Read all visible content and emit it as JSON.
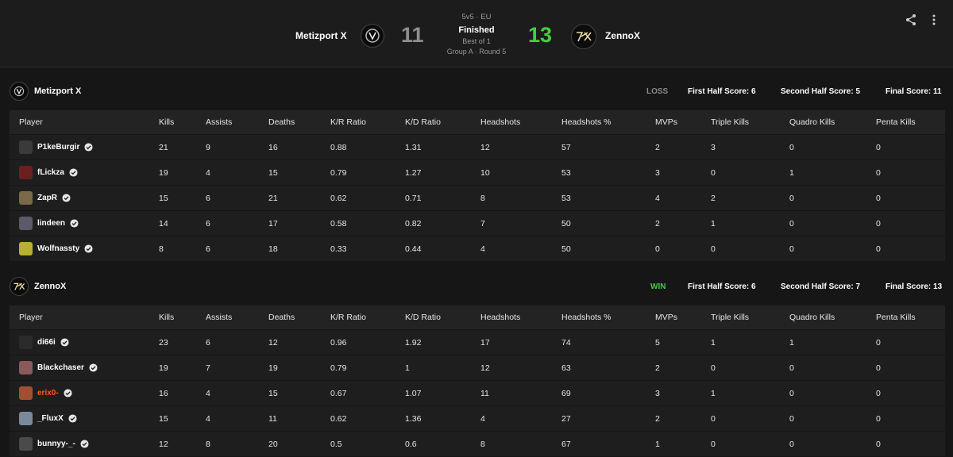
{
  "header": {
    "format": "5v5 · EU",
    "status": "Finished",
    "best_of": "Best of 1",
    "stage": "Group A · Round 5",
    "team1": {
      "name": "Metizport X",
      "score": "11"
    },
    "team2": {
      "name": "ZennoX",
      "score": "13"
    },
    "icons": [
      "share-icon",
      "more-vertical-icon"
    ]
  },
  "colors": {
    "accent": "#ff5500",
    "win": "#3fd13f",
    "loss": "#8a8a8a",
    "background": "#161616",
    "panel": "#1e1e1e"
  },
  "columns": [
    "Player",
    "Kills",
    "Assists",
    "Deaths",
    "K/R Ratio",
    "K/D Ratio",
    "Headshots",
    "Headshots %",
    "MVPs",
    "Triple Kills",
    "Quadro Kills",
    "Penta Kills"
  ],
  "teams": [
    {
      "name": "Metizport X",
      "result": "LOSS",
      "first_half": "First Half Score: 6",
      "second_half": "Second Half Score: 5",
      "final": "Final Score: 11",
      "players": [
        {
          "name": "P1keBurgir",
          "stats": [
            "21",
            "9",
            "16",
            "0.88",
            "1.31",
            "12",
            "57",
            "2",
            "3",
            "0",
            "0"
          ]
        },
        {
          "name": "fLickza",
          "stats": [
            "19",
            "4",
            "15",
            "0.79",
            "1.27",
            "10",
            "53",
            "3",
            "0",
            "1",
            "0"
          ]
        },
        {
          "name": "ZapR",
          "stats": [
            "15",
            "6",
            "21",
            "0.62",
            "0.71",
            "8",
            "53",
            "4",
            "2",
            "0",
            "0"
          ]
        },
        {
          "name": "lindeen",
          "stats": [
            "14",
            "6",
            "17",
            "0.58",
            "0.82",
            "7",
            "50",
            "2",
            "1",
            "0",
            "0"
          ]
        },
        {
          "name": "Wolfnassty",
          "stats": [
            "8",
            "6",
            "18",
            "0.33",
            "0.44",
            "4",
            "50",
            "0",
            "0",
            "0",
            "0"
          ]
        }
      ]
    },
    {
      "name": "ZennoX",
      "result": "WIN",
      "first_half": "First Half Score: 6",
      "second_half": "Second Half Score: 7",
      "final": "Final Score: 13",
      "players": [
        {
          "name": "di66i",
          "stats": [
            "23",
            "6",
            "12",
            "0.96",
            "1.92",
            "17",
            "74",
            "5",
            "1",
            "1",
            "0"
          ]
        },
        {
          "name": "Blackchaser",
          "stats": [
            "19",
            "7",
            "19",
            "0.79",
            "1",
            "12",
            "63",
            "2",
            "0",
            "0",
            "0"
          ]
        },
        {
          "name": "erix0-",
          "stats": [
            "16",
            "4",
            "15",
            "0.67",
            "1.07",
            "11",
            "69",
            "3",
            "1",
            "0",
            "0"
          ],
          "highlight": true
        },
        {
          "name": "_FluxX",
          "stats": [
            "15",
            "4",
            "11",
            "0.62",
            "1.36",
            "4",
            "27",
            "2",
            "0",
            "0",
            "0"
          ]
        },
        {
          "name": "bunnyy-_-",
          "stats": [
            "12",
            "8",
            "20",
            "0.5",
            "0.6",
            "8",
            "67",
            "1",
            "0",
            "0",
            "0"
          ]
        }
      ]
    }
  ]
}
